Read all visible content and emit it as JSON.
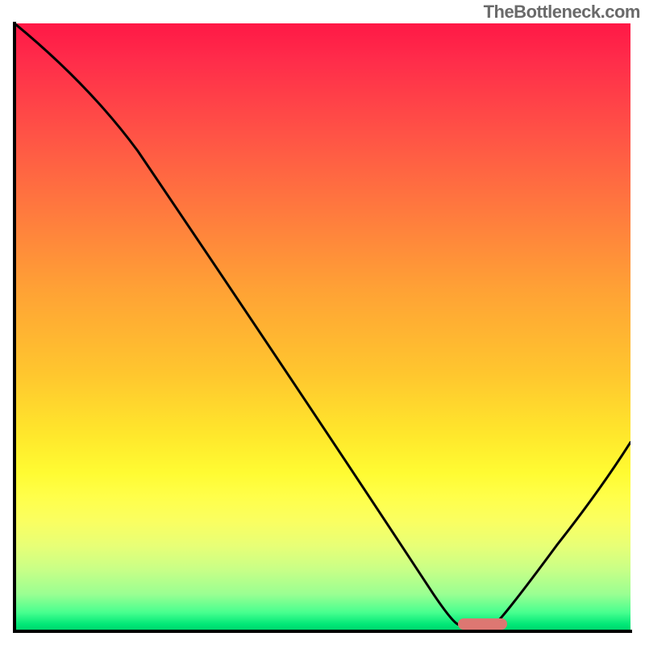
{
  "watermark": "TheBottleneck.com",
  "chart_data": {
    "type": "line",
    "title": "",
    "xlabel": "",
    "ylabel": "",
    "xlim": [
      0,
      100
    ],
    "ylim": [
      0,
      100
    ],
    "grid": false,
    "x": [
      0,
      20,
      72,
      78,
      100
    ],
    "values": [
      100,
      79,
      1,
      1,
      31
    ],
    "gradient": {
      "top_color": "#ff1846",
      "mid_color": "#ffe82c",
      "bottom_color": "#00d46c"
    },
    "marker": {
      "x_start": 72,
      "x_end": 80,
      "y": 1,
      "color": "#dd7772"
    }
  }
}
